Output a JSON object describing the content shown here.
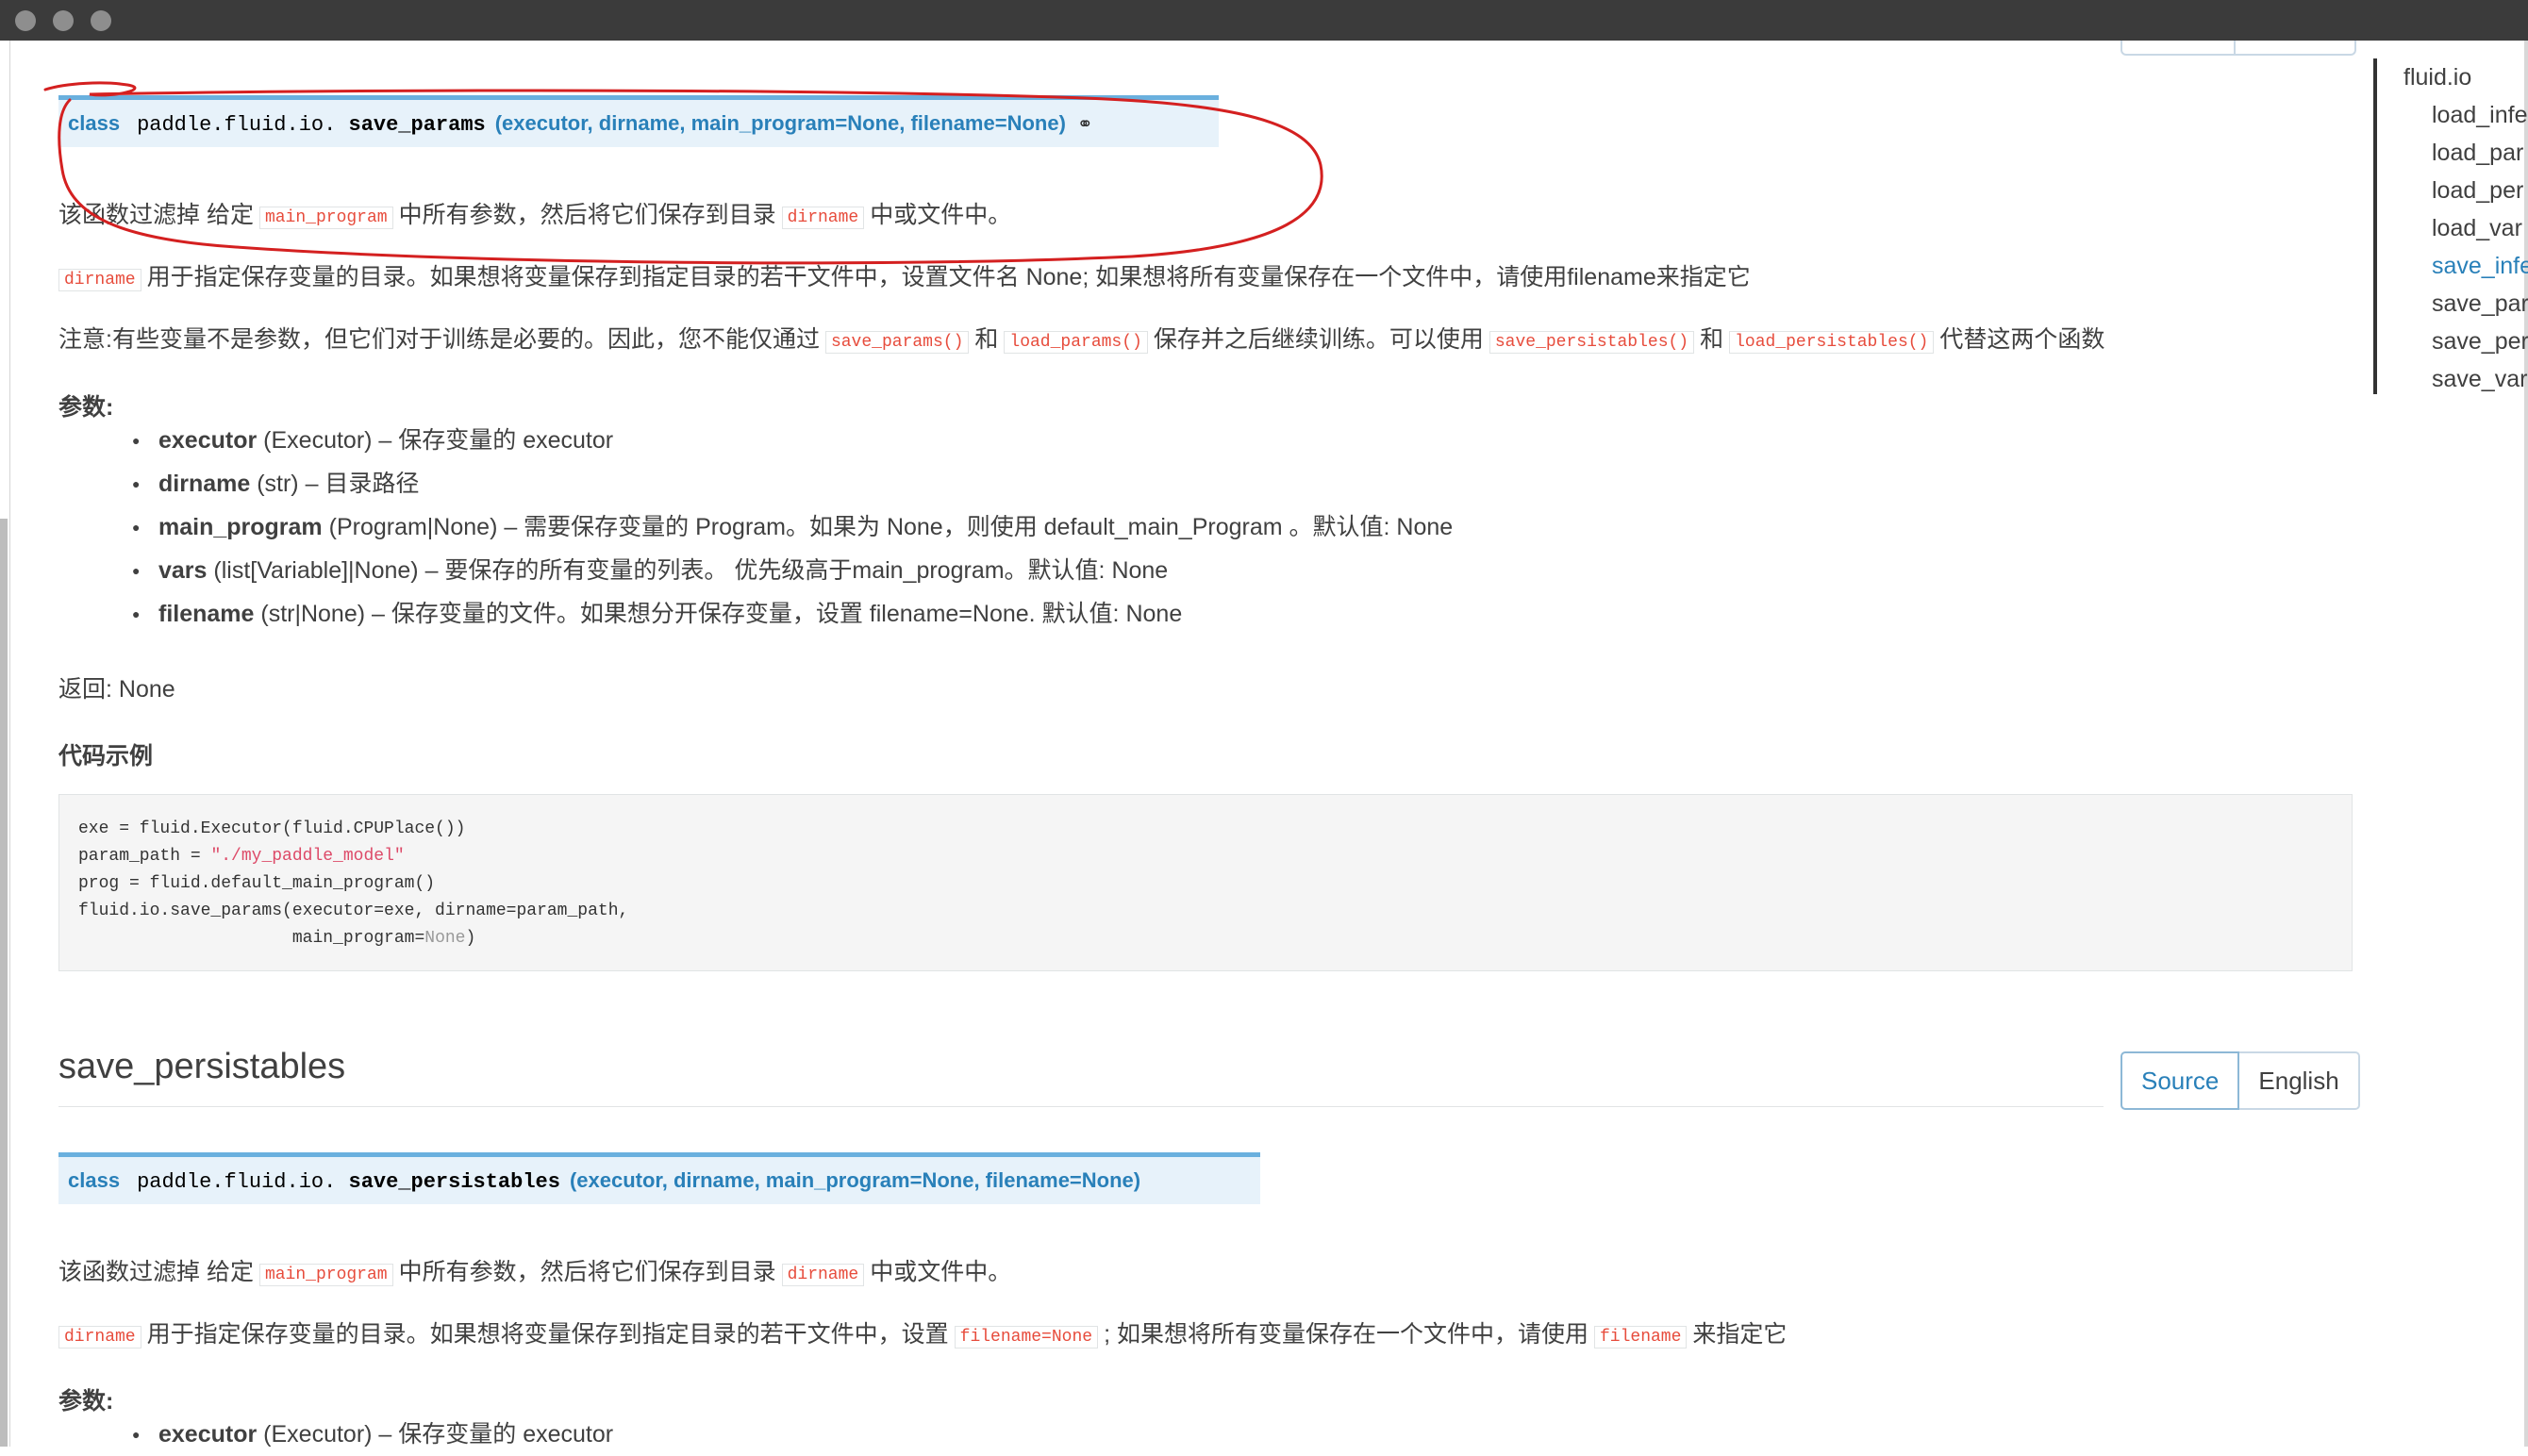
{
  "window": {
    "controls": [
      "close",
      "minimize",
      "maximize"
    ]
  },
  "save_params": {
    "signature": {
      "keyword": "class",
      "name_prefix": "paddle.fluid.io.",
      "name": "save_params",
      "params": "(executor, dirname, main_program=None, filename=None)",
      "link_icon": "⚭"
    },
    "desc1": {
      "a": "该函数过滤掉 给定",
      "code1": "main_program",
      "b": "中所有参数，然后将它们保存到目录",
      "code2": "dirname",
      "c": "中或文件中。"
    },
    "desc2": {
      "code": "dirname",
      "text": "用于指定保存变量的目录。如果想将变量保存到指定目录的若干文件中，设置文件名 None; 如果想将所有变量保存在一个文件中，请使用filename来指定它"
    },
    "desc3": {
      "a": "注意:有些变量不是参数，但它们对于训练是必要的。因此，您不能仅通过",
      "code1": "save_params()",
      "b": "和",
      "code2": "load_params()",
      "c": "保存并之后继续训练。可以使用",
      "code3": "save_persistables()",
      "d": "和",
      "code4": "load_persistables()",
      "e": "代替这两个函数"
    },
    "params_heading": "参数:",
    "params": [
      {
        "name": "executor",
        "rest": " (Executor) – 保存变量的 executor"
      },
      {
        "name": "dirname",
        "rest": " (str) – 目录路径"
      },
      {
        "name": "main_program",
        "rest": " (Program|None) – 需要保存变量的 Program。如果为 None，则使用 default_main_Program 。默认值: None"
      },
      {
        "name": "vars",
        "rest": " (list[Variable]|None) – 要保存的所有变量的列表。 优先级高于main_program。默认值: None"
      },
      {
        "name": "filename",
        "rest": " (str|None) – 保存变量的文件。如果想分开保存变量，设置 filename=None. 默认值: None"
      }
    ],
    "returns": "返回: None",
    "example_heading": "代码示例",
    "code": {
      "l1": "exe = fluid.Executor(fluid.CPUPlace())",
      "l2a": "param_path = ",
      "l2b": "\"./my_paddle_model\"",
      "l3": "prog = fluid.default_main_program()",
      "l4": "fluid.io.save_params(executor=exe, dirname=param_path,",
      "l5a": "                     main_program=",
      "l5b": "None",
      "l5c": ")"
    }
  },
  "save_persistables": {
    "heading": "save_persistables",
    "source_button": "Source",
    "english_button": "English",
    "signature": {
      "keyword": "class",
      "name_prefix": "paddle.fluid.io.",
      "name": "save_persistables",
      "params": "(executor, dirname, main_program=None, filename=None)"
    },
    "desc1": {
      "a": "该函数过滤掉 给定",
      "code1": "main_program",
      "b": "中所有参数，然后将它们保存到目录",
      "code2": "dirname",
      "c": "中或文件中。"
    },
    "desc2": {
      "code1": "dirname",
      "a": "用于指定保存变量的目录。如果想将变量保存到指定目录的若干文件中，设置",
      "code2": "filename=None",
      "b": "; 如果想将所有变量保存在一个文件中，请使用",
      "code3": "filename",
      "c": "来指定它"
    },
    "params_heading": "参数:",
    "params": [
      {
        "name": "executor",
        "rest": " (Executor) – 保存变量的 executor"
      }
    ]
  },
  "toc": {
    "root": "fluid.io",
    "items": [
      "load_infe",
      "load_par",
      "load_per",
      "load_var",
      "save_infe",
      "save_par",
      "save_per",
      "save_var"
    ],
    "active_index": 4
  },
  "colors": {
    "link": "#2980b9",
    "code": "#e74c3c",
    "sig_bg": "#e7f2fa",
    "annotation": "#d42020"
  }
}
